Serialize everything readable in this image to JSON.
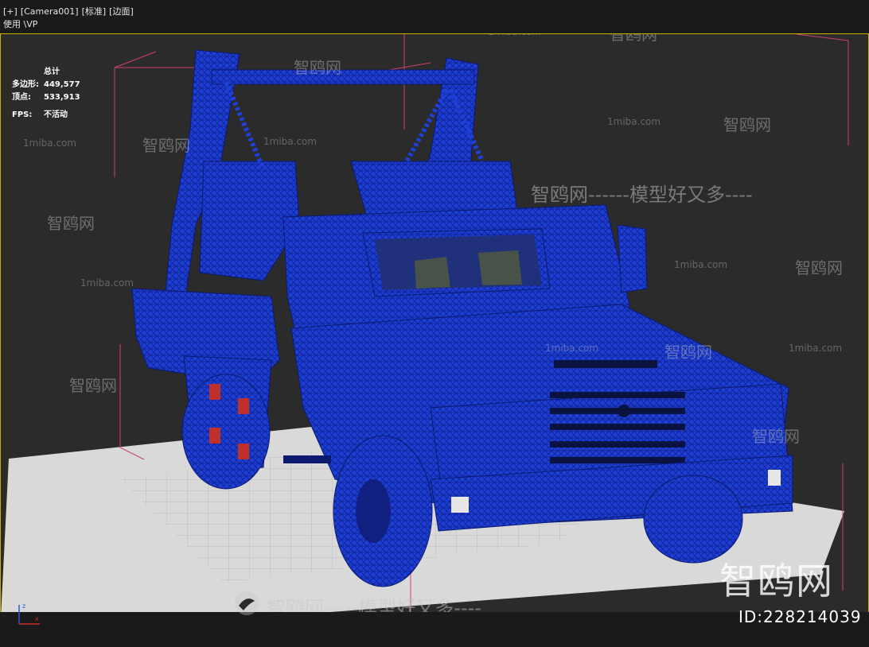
{
  "viewport": {
    "menu": [
      "[+]",
      "[Camera001]",
      "[标准]",
      "[边面]"
    ],
    "wp_text": "使用 \\VP"
  },
  "stats": {
    "header": "总计",
    "polygons_label": "多边形:",
    "polygons_value": "449,577",
    "vertices_label": "顶点:",
    "vertices_value": "533,913",
    "fps_label": "FPS:",
    "fps_value": "不活动"
  },
  "watermarks": {
    "site": "1miba.com",
    "brand": "智鸥网",
    "slogan": "智鸥网-----模型好又多----",
    "slogan2": "智鸥网------模型好又多----",
    "big": "智鸥网",
    "id": "ID:228214039"
  },
  "colors": {
    "wireframe": "#1f3fd6",
    "wire_dark": "#0b1a6e",
    "ground": "#d9d9d9",
    "viewport_border": "#c8b400",
    "bbox": "#d04070"
  },
  "icons": {
    "axis": "axis-gizmo-icon",
    "logo": "brand-logo-icon"
  }
}
